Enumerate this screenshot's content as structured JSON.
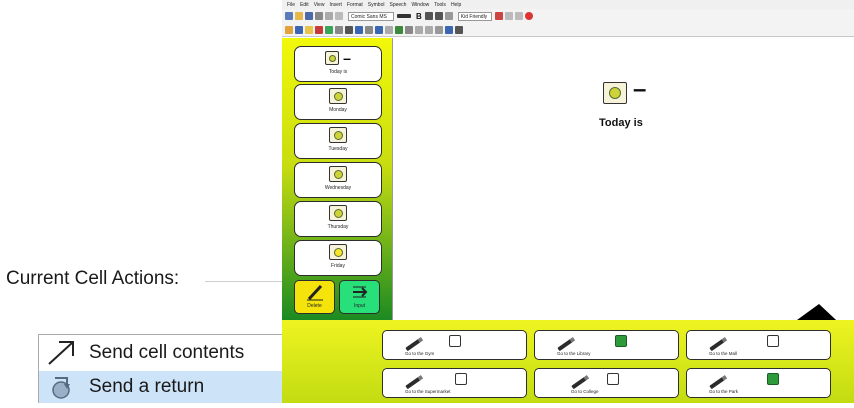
{
  "left_panel": {
    "title": "Current Cell Actions:",
    "actions": [
      {
        "label": "Send cell contents",
        "icon": "arrow-up-right-icon"
      },
      {
        "label": "Send a return",
        "icon": "return-icon",
        "selected": true
      }
    ]
  },
  "app": {
    "menu": [
      "File",
      "Edit",
      "View",
      "Insert",
      "Format",
      "Symbol",
      "Speech",
      "Window",
      "Tools",
      "Help"
    ],
    "toolbar": {
      "font_name": "Comic Sans MS",
      "font_size": "Kid Friendly",
      "bold": "B"
    },
    "sidebar": {
      "top_cell": {
        "label": "Today is"
      },
      "days": [
        "Monday",
        "Tuesday",
        "Wednesday",
        "Thursday",
        "Friday"
      ],
      "delete_label": "Delete",
      "input_label": "Input"
    },
    "main": {
      "today_text": "Today is",
      "dash": "–"
    },
    "places": [
      {
        "label": "Go to the Gym"
      },
      {
        "label": "Go to the Library"
      },
      {
        "label": "Go to the Mall"
      },
      {
        "label": "Go to the Supermarket"
      },
      {
        "label": "Go to College"
      },
      {
        "label": "Go to the Park"
      }
    ],
    "colors": {
      "sidebar_top": "#f2f80a",
      "sidebar_bottom": "#1c8a22",
      "delete_button": "#f5e40c",
      "input_button": "#27e07a",
      "bottom_bar": "#d8e818",
      "selected_row": "#cde3f7"
    }
  }
}
